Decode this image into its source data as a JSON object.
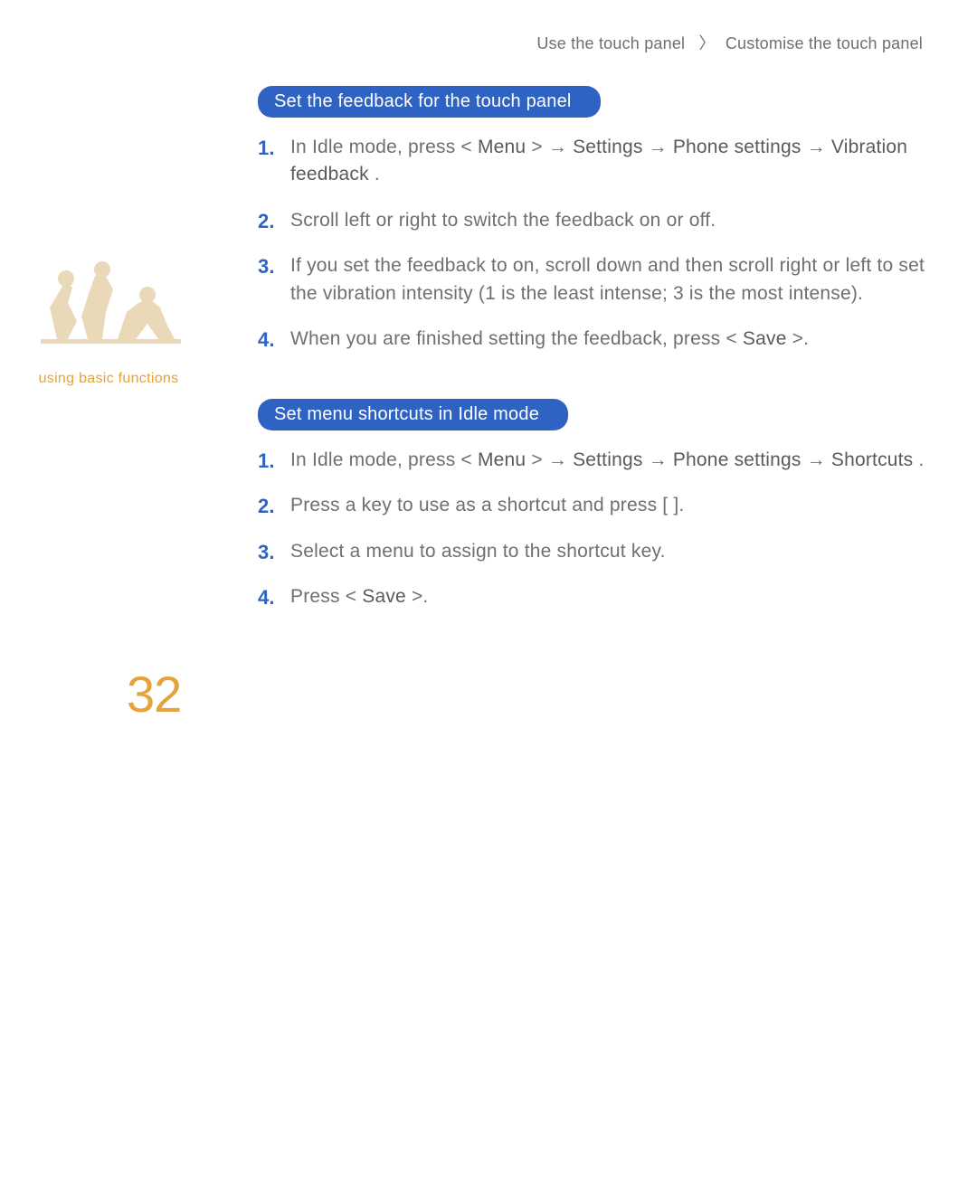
{
  "breadcrumb": {
    "item1": "Use the touch panel",
    "sep": "〉",
    "item2": "Customise the touch panel"
  },
  "sidebar": {
    "caption": "using basic functions",
    "page_number": "32"
  },
  "section1": {
    "heading": "Set the feedback for the touch panel",
    "steps": {
      "s1": {
        "num": "1.",
        "t1": "In Idle mode, press <",
        "b1": "Menu",
        "t2": "> → ",
        "b2": "Settings",
        "t3": " → ",
        "b3": "Phone settings",
        "t4": " → ",
        "b4": "Vibration feedback",
        "t5": "."
      },
      "s2": {
        "num": "2.",
        "text": "Scroll left or right to switch the feedback on or off."
      },
      "s3": {
        "num": "3.",
        "text": "If you set the feedback to on, scroll down and then scroll right or left to set the vibration intensity (1 is the least intense; 3 is the most intense)."
      },
      "s4": {
        "num": "4.",
        "t1": "When you are ﬁnished setting the feedback, press <",
        "b1": "Save",
        "t2": ">."
      }
    }
  },
  "section2": {
    "heading": "Set menu  shortcuts in Idle mode",
    "steps": {
      "s1": {
        "num": "1.",
        "t1": "In Idle mode, press <",
        "b1": "Menu",
        "t2": "> → ",
        "b2": "Settings",
        "t3": " → ",
        "b3": "Phone settings",
        "t4": " → ",
        "b4": "Shortcuts",
        "t5": "."
      },
      "s2": {
        "num": "2.",
        "text": "Press a key to use as a shortcut and press [        ]."
      },
      "s3": {
        "num": "3.",
        "text": "Select a menu to assign to the shortcut key."
      },
      "s4": {
        "num": "4.",
        "t1": "Press <",
        "b1": "Save",
        "t2": ">."
      }
    }
  }
}
